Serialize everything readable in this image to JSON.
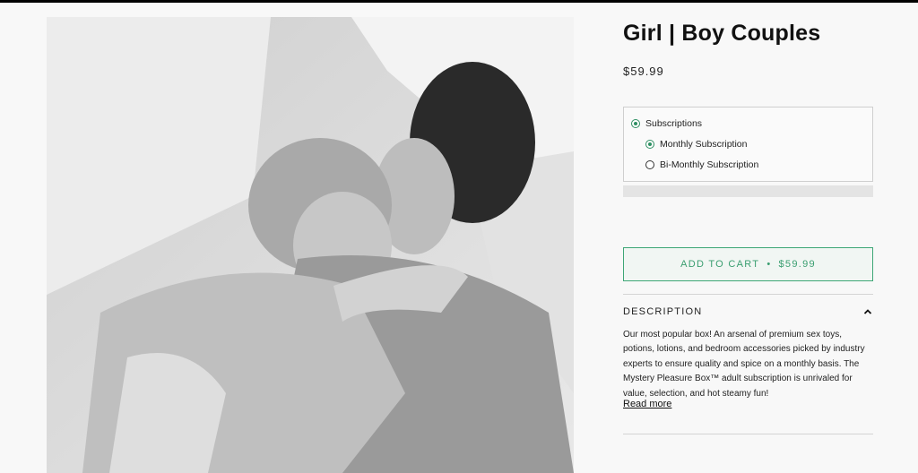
{
  "product": {
    "title": "Girl | Boy Couples",
    "price": "$59.99",
    "image_alt": "couple-photo"
  },
  "subscription": {
    "group_label": "Subscriptions",
    "options": [
      {
        "label": "Monthly Subscription",
        "selected": true
      },
      {
        "label": "Bi-Monthly Subscription",
        "selected": false
      }
    ]
  },
  "cart": {
    "label": "ADD TO CART",
    "separator": "•",
    "price": "$59.99",
    "accent_color": "#3ea676"
  },
  "description": {
    "heading": "DESCRIPTION",
    "text": "Our most popular box! An arsenal of premium sex toys, potions, lotions, and bedroom accessories picked by industry experts to ensure quality and spice on a monthly basis. The Mystery Pleasure Box™ adult subscription is unrivaled for value, selection, and hot steamy fun!",
    "read_more": "Read more"
  },
  "icons": {
    "collapse": "chevron-up-icon"
  }
}
